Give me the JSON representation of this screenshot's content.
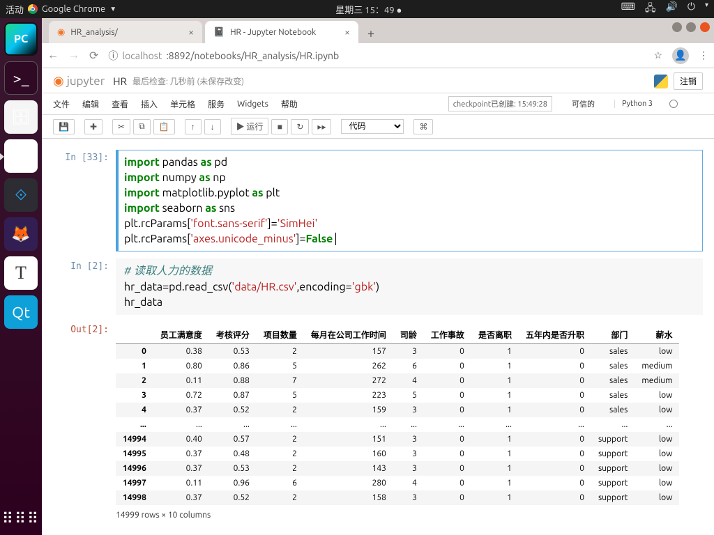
{
  "topbar": {
    "activity": "活动",
    "app": "Google Chrome",
    "datetime": "星期三 15：49",
    "icons": [
      "keyboard",
      "network",
      "volume",
      "power"
    ]
  },
  "launcher": {
    "apps": [
      "pycharm",
      "terminal",
      "files",
      "chrome",
      "vscode",
      "firefox",
      "text",
      "qt"
    ]
  },
  "browser": {
    "tabs": [
      {
        "title": "HR_analysis/",
        "active": false
      },
      {
        "title": "HR - Jupyter Notebook",
        "active": true
      }
    ],
    "url_host": "localhost",
    "url_path": ":8892/notebooks/HR_analysis/HR.ipynb"
  },
  "jupyter": {
    "logo": "jupyter",
    "title": "HR",
    "checkpoint": "最后检查: 几秒前 (未保存改变)",
    "logout": "注销",
    "menus": [
      "文件",
      "编辑",
      "查看",
      "插入",
      "单元格",
      "服务",
      "Widgets",
      "帮助"
    ],
    "checkpoint_ind": "checkpoint已创建: 15:49:28",
    "trusted": "可信的",
    "kernel": "Python 3",
    "toolbar": {
      "save": "💾",
      "add": "✚",
      "cut": "✂",
      "copy": "⧉",
      "paste": "📋",
      "up": "↑",
      "down": "↓",
      "run": "▶ 运行",
      "stop": "■",
      "restart": "↻",
      "ff": "▸▸",
      "celltype": "代码",
      "cmd": "⌘"
    },
    "cells": [
      {
        "prompt": "In [33]:",
        "lines": [
          [
            {
              "t": "import",
              "c": "kw"
            },
            {
              "t": " pandas "
            },
            {
              "t": "as",
              "c": "kw"
            },
            {
              "t": " pd"
            }
          ],
          [
            {
              "t": "import",
              "c": "kw"
            },
            {
              "t": " numpy "
            },
            {
              "t": "as",
              "c": "kw"
            },
            {
              "t": " np"
            }
          ],
          [
            {
              "t": "import",
              "c": "kw"
            },
            {
              "t": " matplotlib.pyplot "
            },
            {
              "t": "as",
              "c": "kw"
            },
            {
              "t": " plt"
            }
          ],
          [
            {
              "t": "import",
              "c": "kw"
            },
            {
              "t": " seaborn "
            },
            {
              "t": "as",
              "c": "kw"
            },
            {
              "t": " sns"
            }
          ],
          [
            {
              "t": "plt.rcParams["
            },
            {
              "t": "'font.sans-serif'",
              "c": "str"
            },
            {
              "t": "]="
            },
            {
              "t": "'SimHei'",
              "c": "str"
            }
          ],
          [
            {
              "t": "plt.rcParams["
            },
            {
              "t": "'axes.unicode_minus'",
              "c": "str"
            },
            {
              "t": "]="
            },
            {
              "t": "False",
              "c": "kw"
            }
          ]
        ]
      },
      {
        "prompt": "In [2]:",
        "lines": [
          [
            {
              "t": "# 读取人力的数据",
              "c": "cmt"
            }
          ],
          [
            {
              "t": "hr_data=pd.read_csv("
            },
            {
              "t": "'data/HR.csv'",
              "c": "str"
            },
            {
              "t": ",encoding="
            },
            {
              "t": "'gbk'",
              "c": "str"
            },
            {
              "t": ")"
            }
          ],
          [
            {
              "t": "hr_data"
            }
          ]
        ]
      }
    ],
    "out_prompt": "Out[2]:",
    "table": {
      "headers": [
        "",
        "员工满意度",
        "考核评分",
        "项目数量",
        "每月在公司工作时间",
        "司龄",
        "工作事故",
        "是否离职",
        "五年内是否升职",
        "部门",
        "薪水"
      ],
      "rows": [
        [
          "0",
          "0.38",
          "0.53",
          "2",
          "157",
          "3",
          "0",
          "1",
          "0",
          "sales",
          "low"
        ],
        [
          "1",
          "0.80",
          "0.86",
          "5",
          "262",
          "6",
          "0",
          "1",
          "0",
          "sales",
          "medium"
        ],
        [
          "2",
          "0.11",
          "0.88",
          "7",
          "272",
          "4",
          "0",
          "1",
          "0",
          "sales",
          "medium"
        ],
        [
          "3",
          "0.72",
          "0.87",
          "5",
          "223",
          "5",
          "0",
          "1",
          "0",
          "sales",
          "low"
        ],
        [
          "4",
          "0.37",
          "0.52",
          "2",
          "159",
          "3",
          "0",
          "1",
          "0",
          "sales",
          "low"
        ],
        [
          "...",
          "...",
          "...",
          "...",
          "...",
          "...",
          "...",
          "...",
          "...",
          "...",
          "..."
        ],
        [
          "14994",
          "0.40",
          "0.57",
          "2",
          "151",
          "3",
          "0",
          "1",
          "0",
          "support",
          "low"
        ],
        [
          "14995",
          "0.37",
          "0.48",
          "2",
          "160",
          "3",
          "0",
          "1",
          "0",
          "support",
          "low"
        ],
        [
          "14996",
          "0.37",
          "0.53",
          "2",
          "143",
          "3",
          "0",
          "1",
          "0",
          "support",
          "low"
        ],
        [
          "14997",
          "0.11",
          "0.96",
          "6",
          "280",
          "4",
          "0",
          "1",
          "0",
          "support",
          "low"
        ],
        [
          "14998",
          "0.37",
          "0.52",
          "2",
          "158",
          "3",
          "0",
          "1",
          "0",
          "support",
          "low"
        ]
      ],
      "caption": "14999 rows × 10 columns"
    }
  }
}
